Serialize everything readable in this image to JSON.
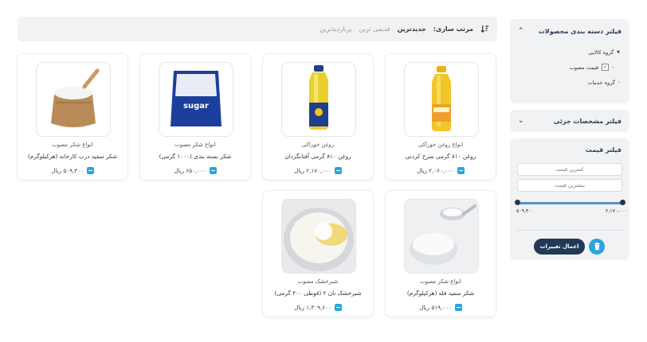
{
  "sort": {
    "label": "مرتب سازی:",
    "options": [
      "جدیدترین",
      "قدیمی ترین",
      "پربازدیدترین"
    ],
    "active": "جدیدترین"
  },
  "products": [
    {
      "category": "انواع روغن خوراکی",
      "name": "روغن ۸۱۰ گرمی سرخ کردنی",
      "price": "۲,۰۶۰,۰۰۰ ریال"
    },
    {
      "category": "روغن خوراکی",
      "name": "روغن ۸۱۰ گرمی آفتابگردان",
      "price": "۲,۱۷۰,۰۰۰ ریال"
    },
    {
      "category": "انواع شکر مصوب",
      "name": "شکر بسته بندی (۱۰۰۰ گرمی)",
      "price": "۶۵۰,۰۰۰ ریال"
    },
    {
      "category": "انواع شکر مصوب",
      "name": "شکر سفید درب کارخانه (هرکیلوگرم)",
      "price": "۵۰۹,۳۰۰ ریال"
    },
    {
      "category": "انواع شکر مصوب",
      "name": "شکر سفید فله (هرکیلوگرم)",
      "price": "۵۱۹,۰۰۰ ریال"
    },
    {
      "category": "شیرخشک مصوب",
      "name": "شیرخشک نان ۲ (قوطی ۴۰۰ گرمی)",
      "price": "۱,۳۰۹,۶۰۰ ریال"
    }
  ],
  "sidebar": {
    "category_filter": {
      "title": "فیلتر دسته بندی محصولات",
      "items": [
        {
          "label": "گروه کالایی"
        },
        {
          "label": "قیمت مصوب",
          "checked": true
        },
        {
          "label": "گروه خدمات"
        }
      ]
    },
    "spec_filter": {
      "title": "فیلتر مشخصات جزئی"
    },
    "price_filter": {
      "title": "فیلتر قیمت",
      "min_placeholder": "کمترین قیمت",
      "max_placeholder": "بیشترین قیمت",
      "range_min": "۵۰۹,۳۰۰",
      "range_max": "۲,۱۷۰,۰۰۰",
      "apply_label": "اعمال تغییرات"
    }
  },
  "colors": {
    "accent": "#2aa5dc",
    "primary": "#203956",
    "panel_bg": "#f1f2f4"
  },
  "icons": {
    "sort": "sort-icon",
    "cart": "cart-icon",
    "trash": "trash-icon",
    "chevron": "chevron-icon"
  }
}
